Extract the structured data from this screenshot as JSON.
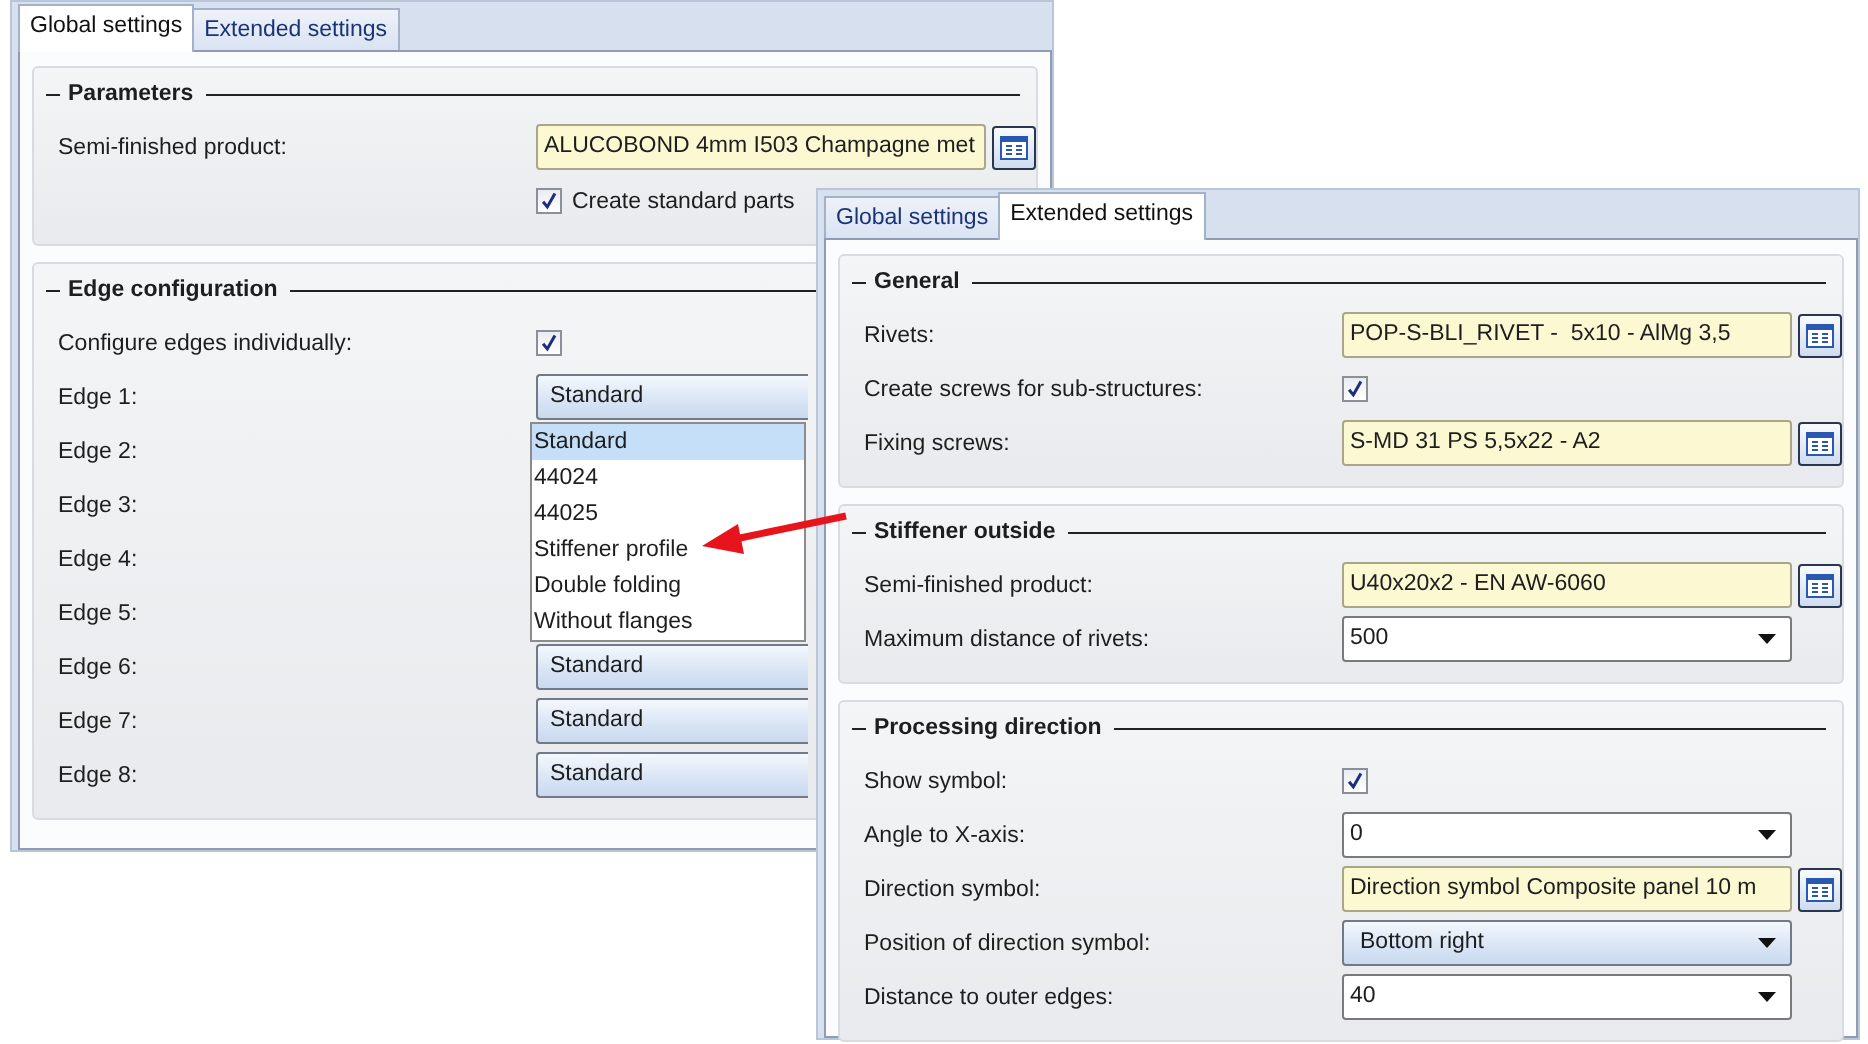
{
  "windows": [
    {
      "tabs": [
        {
          "label": "Global settings",
          "selected": true
        },
        {
          "label": "Extended settings",
          "selected": false
        }
      ],
      "groups": [
        {
          "title": "Parameters",
          "rows": [
            {
              "kind": "lookup",
              "label": "Semi-finished product:",
              "value": "ALUCOBOND 4mm I503 Champagne met"
            },
            {
              "kind": "inline_checkbox",
              "label": "Create standard parts",
              "checked": true
            }
          ]
        },
        {
          "title": "Edge configuration",
          "rows": [
            {
              "kind": "checkbox",
              "label": "Configure edges individually:",
              "checked": true
            },
            {
              "kind": "clipped_select",
              "label": "Edge 1:",
              "value": "Standard",
              "open_list": [
                {
                  "label": "Standard",
                  "selected": true
                },
                {
                  "label": "44024",
                  "selected": false
                },
                {
                  "label": "44025",
                  "selected": false
                },
                {
                  "label": "Stiffener profile",
                  "selected": false
                },
                {
                  "label": "Double folding",
                  "selected": false
                },
                {
                  "label": "Without flanges",
                  "selected": false
                }
              ]
            },
            {
              "kind": "label",
              "label": "Edge 2:"
            },
            {
              "kind": "label",
              "label": "Edge 3:"
            },
            {
              "kind": "label",
              "label": "Edge 4:"
            },
            {
              "kind": "label",
              "label": "Edge 5:"
            },
            {
              "kind": "clipped_select",
              "label": "Edge 6:",
              "value": "Standard"
            },
            {
              "kind": "clipped_select",
              "label": "Edge 7:",
              "value": "Standard"
            },
            {
              "kind": "clipped_select",
              "label": "Edge 8:",
              "value": "Standard"
            }
          ]
        }
      ]
    },
    {
      "tabs": [
        {
          "label": "Global settings",
          "selected": false
        },
        {
          "label": "Extended settings",
          "selected": true
        }
      ],
      "groups": [
        {
          "title": "General",
          "rows": [
            {
              "kind": "lookup",
              "label": "Rivets:",
              "value": "POP-S-BLI_RIVET -  5x10 - AlMg 3,5"
            },
            {
              "kind": "checkbox",
              "label": "Create screws for sub-structures:",
              "checked": true
            },
            {
              "kind": "lookup",
              "label": "Fixing screws:",
              "value": "S-MD 31 PS 5,5x22 - A2"
            }
          ]
        },
        {
          "title": "Stiffener outside",
          "rows": [
            {
              "kind": "lookup",
              "label": "Semi-finished product:",
              "value": "U40x20x2 - EN AW-6060"
            },
            {
              "kind": "combo",
              "label": "Maximum distance of rivets:",
              "value": "500"
            }
          ]
        },
        {
          "title": "Processing direction",
          "rows": [
            {
              "kind": "checkbox",
              "label": "Show symbol:",
              "checked": true
            },
            {
              "kind": "combo",
              "label": "Angle to X-axis:",
              "value": "0"
            },
            {
              "kind": "lookup",
              "label": "Direction symbol:",
              "value": "Direction symbol Composite panel 10 m"
            },
            {
              "kind": "select",
              "label": "Position of direction symbol:",
              "value": "Bottom right"
            },
            {
              "kind": "combo",
              "label": "Distance to outer edges:",
              "value": "40"
            }
          ]
        }
      ]
    }
  ]
}
